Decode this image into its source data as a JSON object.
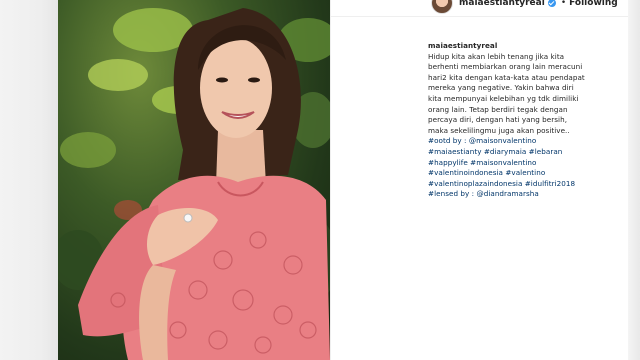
{
  "header": {
    "username": "maiaestiantyreal",
    "separator": "•",
    "follow_status": "Following"
  },
  "caption": {
    "username": "maiaestiantyreal",
    "lines": [
      "Hidup kita akan lebih tenang jika kita",
      "berhenti membiarkan orang lain meracuni",
      "hari2 kita dengan kata-kata atau pendapat",
      "mereka yang negative. Yakin bahwa diri",
      "kita mempunyai kelebihan yg tdk dimiliki",
      "orang lain. Tetap berdiri tegak dengan",
      "percaya diri, dengan hati yang bersih,",
      "maka sekelilingmu juga akan positive.."
    ],
    "tag_lines": [
      "#ootd by : @maisonvalentino",
      "#maiaestianty #diarymaia #lebaran",
      "#happylife #maisonvalentino",
      "#valentinoindonesia #valentino",
      "#valentinoplazaindonesia #idulfitri2018",
      "#lensed by : @diandramarsha"
    ]
  },
  "colors": {
    "dress": "#e97f84",
    "foliage": "#3c5a26",
    "link": "#003569",
    "verified": "#3897f0"
  }
}
